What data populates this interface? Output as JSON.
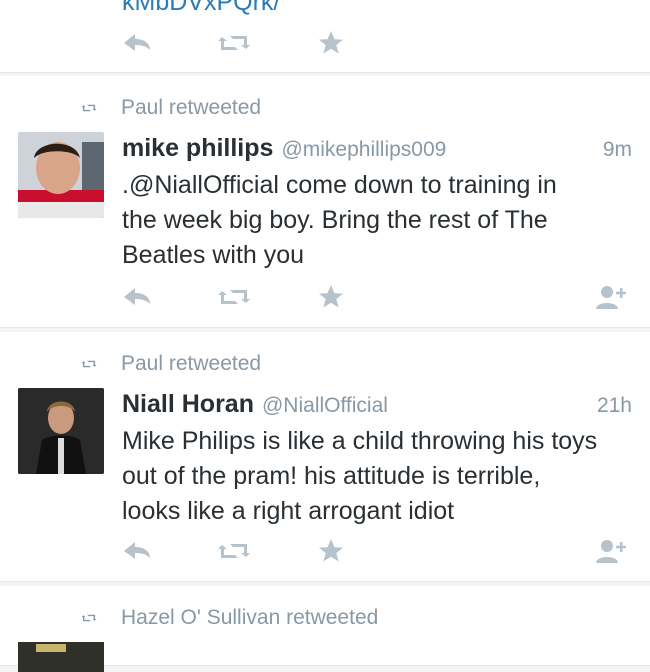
{
  "timeline": {
    "partial_top": {
      "clipped_link_text": "kMbDVxPQrk/"
    },
    "tweets": [
      {
        "retweeted_by": "Paul retweeted",
        "name": "mike phillips",
        "handle": "@mikephillips009",
        "time": "9m",
        "text": ".@NiallOfficial come down to training in\nthe week big boy. Bring the rest of The\nBeatles with you"
      },
      {
        "retweeted_by": "Paul retweeted",
        "name": "Niall Horan",
        "handle": "@NiallOfficial",
        "time": "21h",
        "text": "Mike Philips is like a child throwing his toys\nout of the pram! his attitude is terrible,\nlooks like a right arrogant idiot"
      }
    ],
    "partial_bottom": {
      "retweeted_by": "Hazel O' Sullivan retweeted"
    }
  },
  "icons": {
    "reply": "reply-icon",
    "retweet": "retweet-icon",
    "favorite": "star-icon",
    "follow": "follow-icon"
  },
  "colors": {
    "muted": "#8899a6",
    "text": "#292f33",
    "link": "#2b7bb9",
    "action_icon": "#b7c3cc",
    "divider": "#e1e8ed"
  }
}
